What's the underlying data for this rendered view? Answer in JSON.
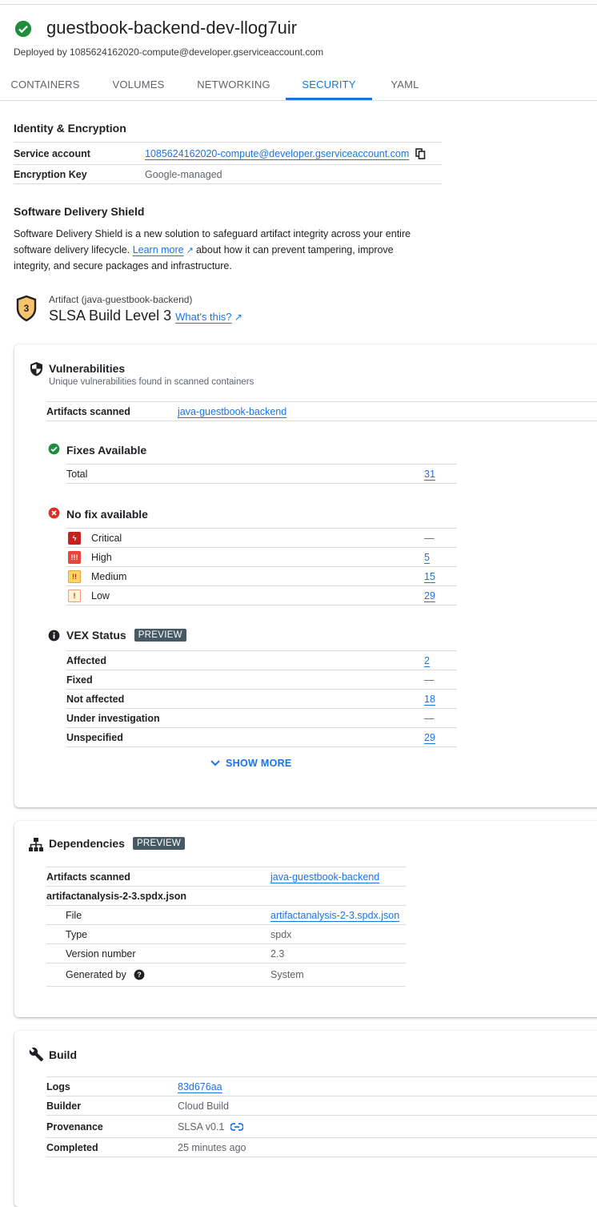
{
  "header": {
    "title": "guestbook-backend-dev-llog7uir",
    "subtitle": "Deployed by 1085624162020-compute@developer.gserviceaccount.com",
    "status_color": "#1e8e3e"
  },
  "tabs": [
    {
      "label": "CONTAINERS"
    },
    {
      "label": "VOLUMES"
    },
    {
      "label": "NETWORKING"
    },
    {
      "label": "SECURITY",
      "active": true
    },
    {
      "label": "YAML"
    }
  ],
  "identity": {
    "heading": "Identity & Encryption",
    "service_account_label": "Service account",
    "service_account_value": "1085624162020-compute@developer.gserviceaccount.com",
    "encryption_label": "Encryption Key",
    "encryption_value": "Google-managed"
  },
  "sds": {
    "heading": "Software Delivery Shield",
    "text_1": "Software Delivery Shield is a new solution to safeguard artifact integrity across your entire software delivery lifecycle.",
    "learn_more": "Learn more",
    "text_2": "about how it can prevent tampering, improve integrity, and secure packages and infrastructure."
  },
  "slsa": {
    "badge_number": "3",
    "artifact": "Artifact (java-guestbook-backend)",
    "level": "SLSA Build Level 3",
    "whats_this": "What's this?"
  },
  "vulnerabilities": {
    "heading": "Vulnerabilities",
    "subtitle": "Unique vulnerabilities found in scanned containers",
    "artifacts_label": "Artifacts scanned",
    "artifacts_value": "java-guestbook-backend",
    "fixes_heading": "Fixes Available",
    "total_label": "Total",
    "total_value": "31",
    "nofix_heading": "No fix available",
    "severities": [
      {
        "label": "Critical",
        "value": "—",
        "color": "#c5221f"
      },
      {
        "label": "High",
        "value": "5",
        "color": "#e8453c"
      },
      {
        "label": "Medium",
        "value": "15",
        "color": "#fbbc04"
      },
      {
        "label": "Low",
        "value": "29",
        "color": "#fce8b2"
      }
    ],
    "vex_heading": "VEX Status",
    "preview": "PREVIEW",
    "vex": [
      {
        "label": "Affected",
        "value": "2"
      },
      {
        "label": "Fixed",
        "value": "—"
      },
      {
        "label": "Not affected",
        "value": "18"
      },
      {
        "label": "Under investigation",
        "value": "—"
      },
      {
        "label": "Unspecified",
        "value": "29"
      }
    ],
    "show_more": "SHOW MORE"
  },
  "dependencies": {
    "heading": "Dependencies",
    "preview": "PREVIEW",
    "artifacts_label": "Artifacts scanned",
    "artifacts_value": "java-guestbook-backend",
    "sbom_name": "artifactanalysis-2-3.spdx.json",
    "file_label": "File",
    "file_value": "artifactanalysis-2-3.spdx.json",
    "type_label": "Type",
    "type_value": "spdx",
    "version_label": "Version number",
    "version_value": "2.3",
    "generated_label": "Generated by",
    "generated_value": "System"
  },
  "build": {
    "heading": "Build",
    "logs_label": "Logs",
    "logs_value": "83d676aa",
    "builder_label": "Builder",
    "builder_value": "Cloud Build",
    "provenance_label": "Provenance",
    "provenance_value": "SLSA v0.1",
    "completed_label": "Completed",
    "completed_value": "25 minutes ago"
  }
}
